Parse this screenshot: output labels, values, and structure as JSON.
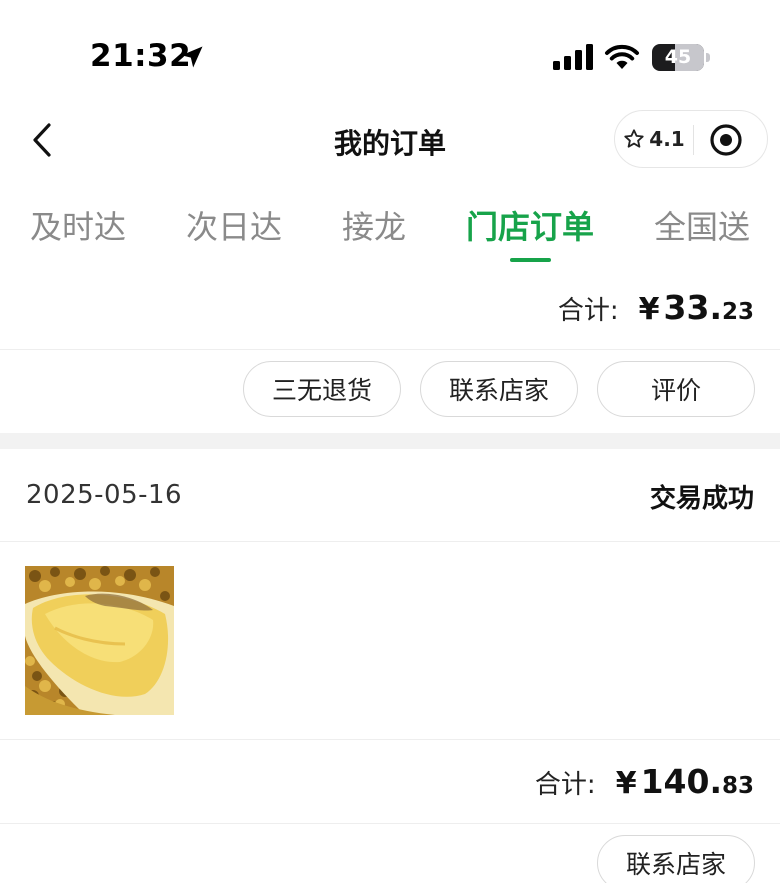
{
  "status_bar": {
    "time": "21:32",
    "battery_level": "45",
    "battery_fraction": 0.45
  },
  "nav": {
    "title": "我的订单",
    "rating": "4.1",
    "back_icon": "chevron-left-icon",
    "rating_icon": "star-outline-icon",
    "record_icon": "target-record-icon"
  },
  "tabs": [
    {
      "label": "及时达",
      "active": false
    },
    {
      "label": "次日达",
      "active": false
    },
    {
      "label": "接龙",
      "active": false
    },
    {
      "label": "门店订单",
      "active": true
    },
    {
      "label": "全国送",
      "active": false
    }
  ],
  "previous_order": {
    "total_label": "合计:",
    "currency": "¥",
    "total_int": "33.",
    "total_dec": "23",
    "actions": [
      "三无退货",
      "联系店家",
      "评价"
    ]
  },
  "order": {
    "date": "2025-05-16",
    "status": "交易成功",
    "product_image": "durian-photo",
    "total_label": "合计:",
    "currency": "¥",
    "total_int": "140.",
    "total_dec": "83",
    "actions": [
      "联系店家"
    ]
  },
  "colors": {
    "accent_green": "#17a34a",
    "text_primary": "#111111",
    "text_secondary": "#8a8a8a",
    "divider": "#eeeeee",
    "section_gap": "#f2f2f2"
  }
}
